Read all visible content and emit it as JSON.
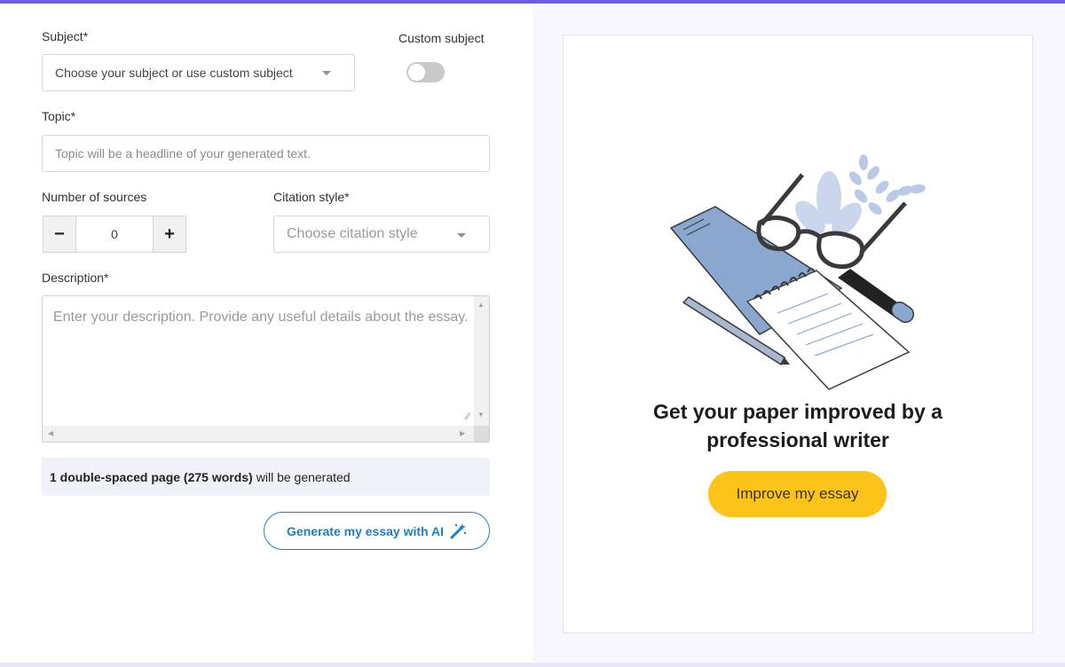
{
  "form": {
    "subject": {
      "label": "Subject*",
      "value": "Choose your subject or use custom subject"
    },
    "custom_subject": {
      "label": "Custom subject",
      "checked": false
    },
    "topic": {
      "label": "Topic*",
      "placeholder": "Topic will be a headline of your generated text."
    },
    "sources": {
      "label": "Number of sources",
      "minus": "−",
      "plus": "+",
      "value": "0"
    },
    "citation": {
      "label": "Citation style*",
      "value": "Choose citation style"
    },
    "description": {
      "label": "Description*",
      "placeholder": "Enter your description. Provide any useful details about the essay."
    },
    "info": {
      "bold": "1 double-spaced page (275 words)",
      "rest": "will be generated"
    },
    "generate_button": "Generate my essay with AI"
  },
  "promo": {
    "headline": "Get your paper improved by a professional writer",
    "button": "Improve my essay"
  },
  "colors": {
    "accent_bar": "#6c5ce7",
    "link_blue": "#1a7fc4",
    "promo_button": "#fcc419",
    "right_bg": "#f8f7ff"
  },
  "icons": {
    "select_caret": "chevron-down-icon",
    "toggle": "toggle-off",
    "wand": "magic-wand-icon"
  }
}
